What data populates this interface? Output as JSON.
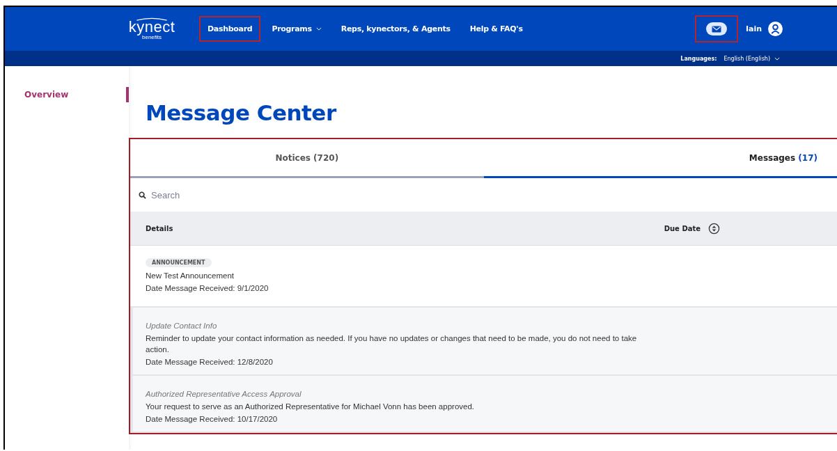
{
  "header": {
    "logo": {
      "name": "kynect",
      "sub": "benefits"
    },
    "nav": [
      {
        "label": "Dashboard",
        "dropdown": false,
        "highlighted": true
      },
      {
        "label": "Programs",
        "dropdown": true,
        "highlighted": false
      },
      {
        "label": "Reps, kynectors, & Agents",
        "dropdown": false,
        "highlighted": false
      },
      {
        "label": "Help & FAQ's",
        "dropdown": false,
        "highlighted": false
      }
    ],
    "mail_highlighted": true,
    "user": "Iain"
  },
  "language_bar": {
    "label": "Languages:",
    "value": "English (English)"
  },
  "sidebar": {
    "items": [
      {
        "label": "Overview",
        "selected": true
      }
    ]
  },
  "page_title": "Message Center",
  "panel": {
    "highlighted": true,
    "tabs": [
      {
        "label": "Notices",
        "count": "(720)",
        "selected": false
      },
      {
        "label": "Messages",
        "count": "(17)",
        "selected": true
      }
    ],
    "search": {
      "placeholder": "Search"
    },
    "columns": [
      "Details",
      "Due Date"
    ],
    "rows": [
      {
        "kind": "announcement",
        "tag": "ANNOUNCEMENT",
        "title": "New Test Announcement",
        "date": "Date Message Received: 9/1/2020"
      },
      {
        "kind": "message",
        "title": "Update Contact Info",
        "body": "Reminder to update your contact information as needed. If you have no updates or changes that need to be made, you do not need to take action.",
        "date": "Date Message Received: 12/8/2020"
      },
      {
        "kind": "message",
        "title": "Authorized Representative Access Approval",
        "body": "Your request to serve as an Authorized Representative for Michael Vonn has been approved.",
        "date": "Date Message Received: 10/17/2020"
      }
    ]
  }
}
